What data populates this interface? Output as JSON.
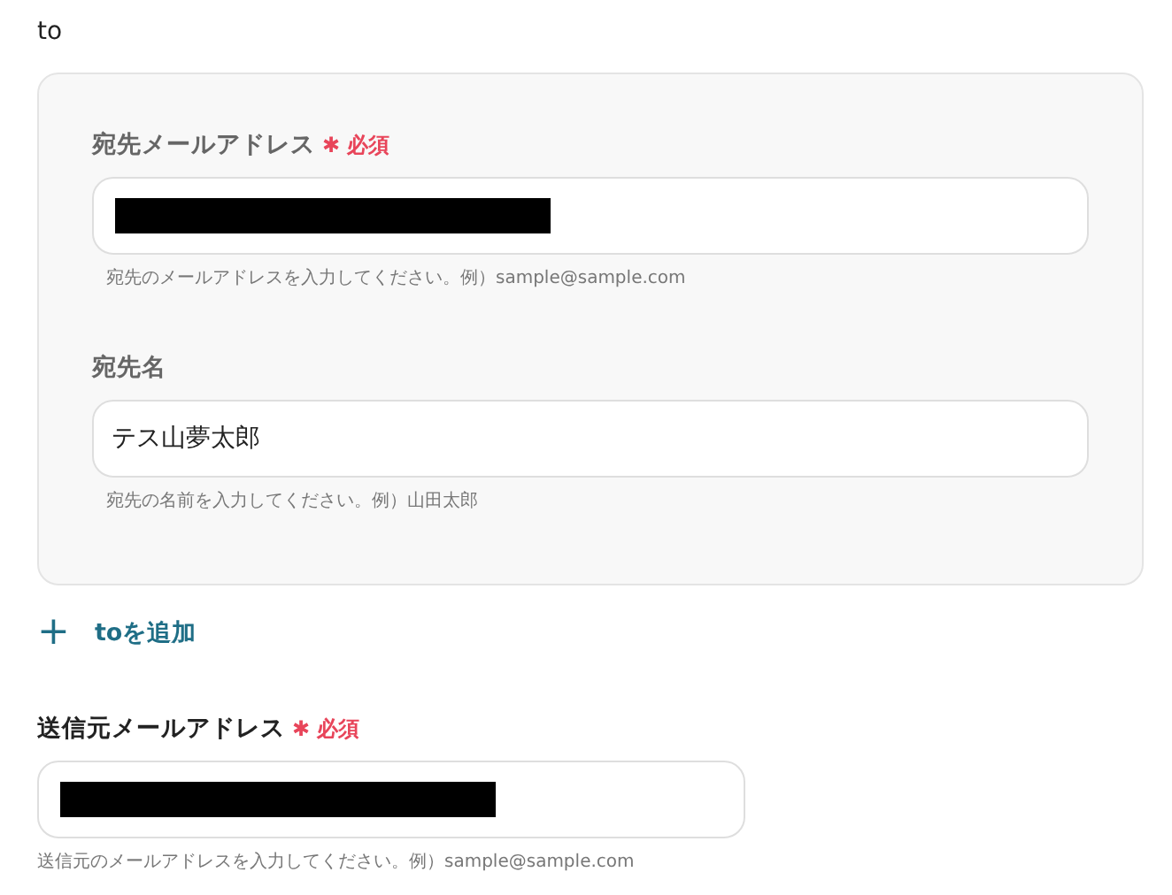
{
  "section_label": "to",
  "recipients": [
    {
      "label": "宛先メールアドレス",
      "required": true,
      "required_mark": "✱",
      "required_text": "必須",
      "redacted": true,
      "hint": "宛先のメールアドレスを入力してください。例）sample@sample.com"
    },
    {
      "label": "宛先名",
      "value": "テス山夢太郎",
      "hint": "宛先の名前を入力してください。例）山田太郎"
    }
  ],
  "add_button": {
    "icon": "+",
    "label": "toを追加"
  },
  "sender": {
    "label": "送信元メールアドレス",
    "required": true,
    "required_mark": "✱",
    "required_text": "必須",
    "redacted": true,
    "hint": "送信元のメールアドレスを入力してください。例）sample@sample.com"
  }
}
